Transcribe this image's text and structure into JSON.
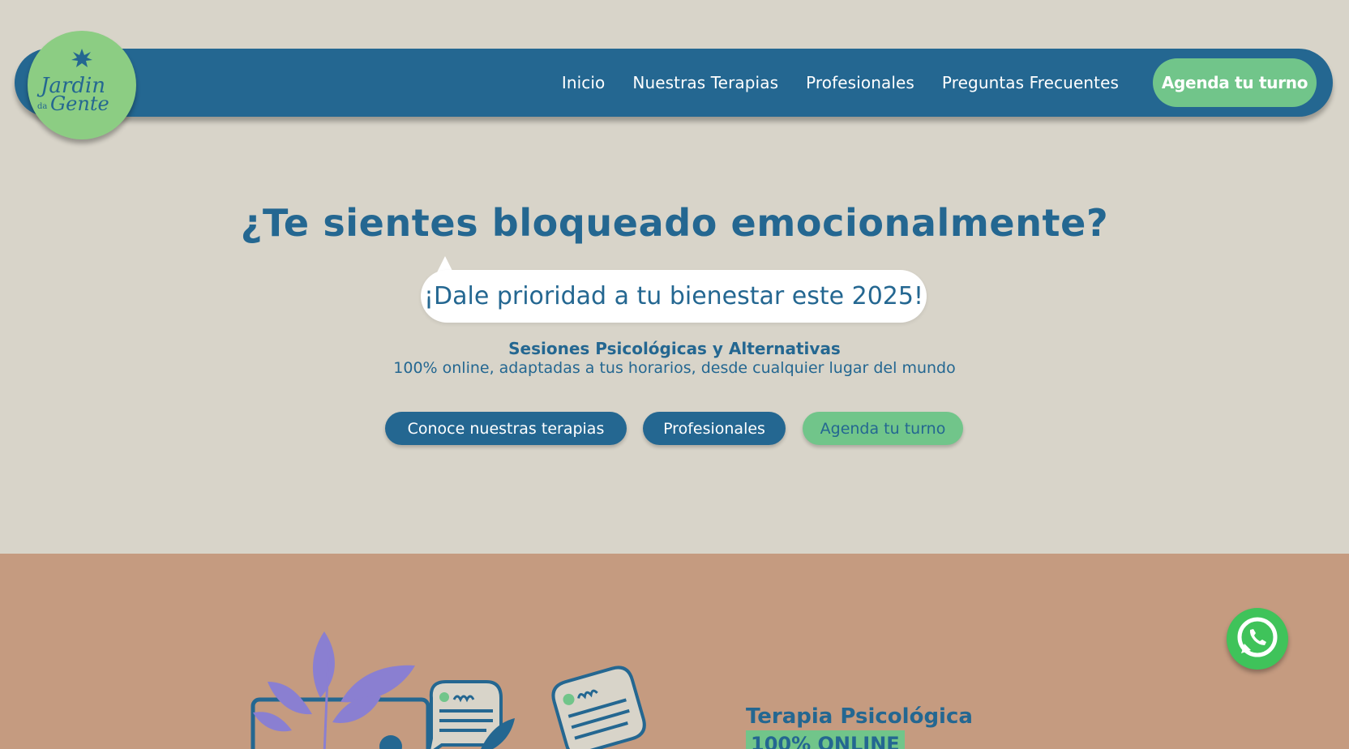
{
  "brand": {
    "logo_line1": "Jardin",
    "logo_small": "da",
    "logo_line2": "Gente",
    "colors": {
      "primary": "#246791",
      "accent": "#71c58a",
      "background": "#d8d4c9",
      "section": "#c59b80"
    }
  },
  "nav": {
    "links": [
      "Inicio",
      "Nuestras Terapias",
      "Profesionales",
      "Preguntas Frecuentes"
    ],
    "cta_label": "Agenda tu turno"
  },
  "hero": {
    "headline": "¿Te sientes bloqueado emocionalmente?",
    "bubble_text": "¡Dale prioridad a tu bienestar este 2025!",
    "subtitle": "Sesiones Psicológicas y Alternativas",
    "subtext": "100% online, adaptadas a tus horarios, desde cualquier lugar del mundo",
    "buttons": {
      "therapies": "Conoce nuestras terapias",
      "professionals": "Profesionales",
      "agenda": "Agenda tu turno"
    }
  },
  "section2": {
    "title": "Terapia Psicológica",
    "badge": "100% ONLINE"
  },
  "icons": [
    "star-icon",
    "whatsapp-icon",
    "plant-illustration",
    "chat-bubble-illustration"
  ]
}
